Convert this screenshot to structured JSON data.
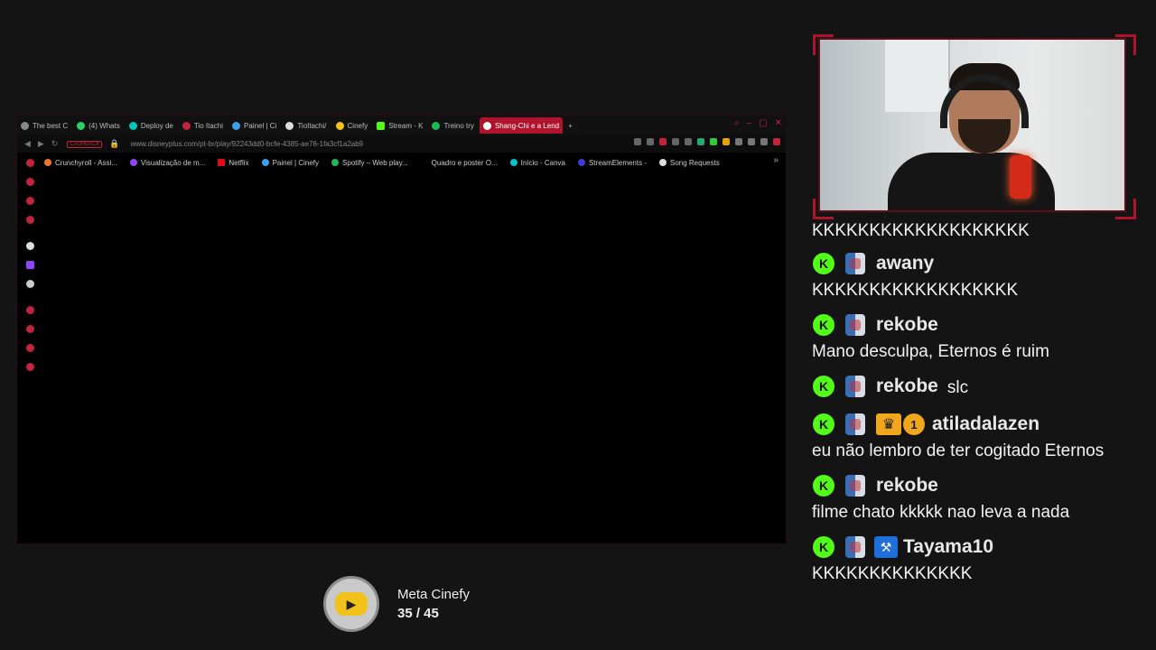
{
  "browser": {
    "tabs": [
      {
        "label": "The best C",
        "color": "#888888"
      },
      {
        "label": "(4) Whats",
        "color": "#25d366"
      },
      {
        "label": "Deploy de",
        "color": "#00c7b7"
      },
      {
        "label": "Tio Itachi",
        "color": "#c2243c"
      },
      {
        "label": "Painel | Ci",
        "color": "#3aa0e8"
      },
      {
        "label": "TioItachi/",
        "color": "#dddddd"
      },
      {
        "label": "Cinefy",
        "color": "#f2c21b"
      },
      {
        "label": "Stream - K",
        "color": "#53fc18"
      },
      {
        "label": "Treino try",
        "color": "#1db954"
      },
      {
        "label": "Shang-Chi e a Lend",
        "color": "#ffffff",
        "active": true
      }
    ],
    "new_tab": "+",
    "window_controls": [
      "⌕",
      "–",
      "▢",
      "✕"
    ],
    "cashback": "CASHBACK",
    "url": "www.disneyplus.com/pt-br/play/92243dd0-bcfe-4385-ae76-1fa3cf1a2ab9",
    "bookmarks": [
      {
        "label": "Crunchyroll - Assi...",
        "color": "#f47521"
      },
      {
        "label": "Visualização de m...",
        "color": "#9146ff"
      },
      {
        "label": "Netflix",
        "color": "#e50914"
      },
      {
        "label": "Painel | Cinefy",
        "color": "#3aa0e8"
      },
      {
        "label": "Spotify – Web play...",
        "color": "#1db954"
      },
      {
        "label": "Quadro e poster O...",
        "color": "#000000"
      },
      {
        "label": "Início - Canva",
        "color": "#00c4cc"
      },
      {
        "label": "StreamElements -",
        "color": "#3b3bd6"
      },
      {
        "label": "Song Requests",
        "color": "#dddddd"
      }
    ],
    "bookmarks_more": "»"
  },
  "goal": {
    "title": "Meta Cinefy",
    "progress": "35 / 45",
    "icon": "cinefy-logo-icon"
  },
  "chat": {
    "messages": [
      {
        "type": "text",
        "text": "KKKKKKKKKKKKKKKKKKK"
      },
      {
        "type": "header",
        "user": "awany",
        "badges": [
          "kick",
          "mod"
        ]
      },
      {
        "type": "text",
        "text": "KKKKKKKKKKKKKKKKKK"
      },
      {
        "type": "header",
        "user": "rekobe",
        "badges": [
          "kick",
          "mod"
        ]
      },
      {
        "type": "text",
        "text": "Mano desculpa, Eternos é ruim"
      },
      {
        "type": "header",
        "user": "rekobe",
        "badges": [
          "kick",
          "mod"
        ],
        "inline": "slc"
      },
      {
        "type": "header",
        "user": "atiladalazen",
        "badges": [
          "kick",
          "mod",
          "crown",
          "sub"
        ],
        "sub_months": "1"
      },
      {
        "type": "text",
        "text": "eu não lembro de ter cogitado Eternos"
      },
      {
        "type": "header",
        "user": "rekobe",
        "badges": [
          "kick",
          "mod"
        ]
      },
      {
        "type": "text",
        "text": "filme chato kkkkk nao leva a nada"
      },
      {
        "type": "header",
        "user": "Tayama10",
        "badges": [
          "kick",
          "mod",
          "hammer"
        ]
      },
      {
        "type": "text",
        "text": "KKKKKKKKKKKKKK"
      }
    ],
    "kick_badge_letter": "K"
  }
}
